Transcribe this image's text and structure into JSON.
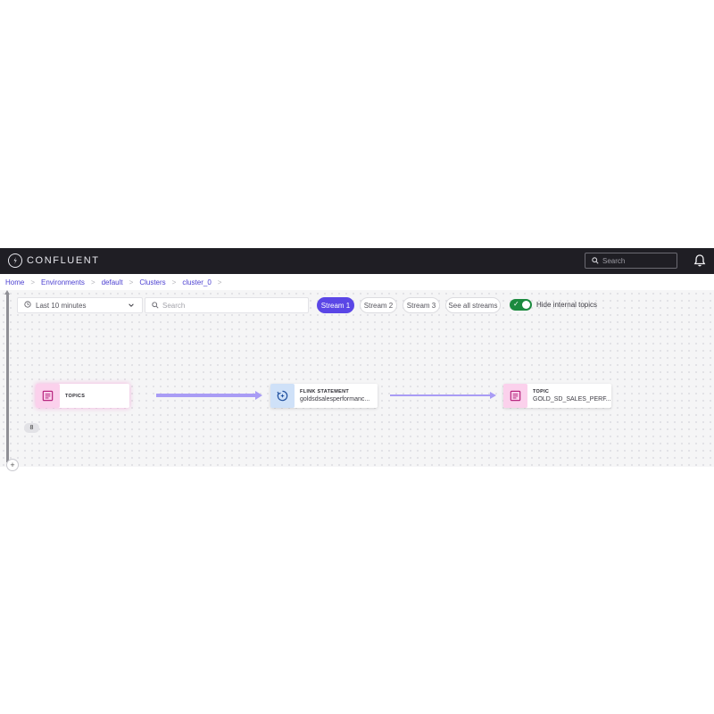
{
  "app": {
    "brand": "CONFLUENT",
    "search_placeholder": "Search"
  },
  "breadcrumb": [
    "Home",
    "Environments",
    "default",
    "Clusters",
    "cluster_0"
  ],
  "toolbar": {
    "time_range": "Last 10 minutes",
    "search_placeholder": "Search",
    "streams": [
      {
        "label": "Stream 1",
        "active": true
      },
      {
        "label": "Stream 2",
        "active": false
      },
      {
        "label": "Stream 3",
        "active": false
      }
    ],
    "see_all_label": "See all streams",
    "hide_internal_label": "Hide internal topics",
    "hide_internal_on": true
  },
  "graph": {
    "nodes": [
      {
        "type_label": "TOPICS",
        "name": "",
        "icon": "topic-icon",
        "count": "8"
      },
      {
        "type_label": "FLINK STATEMENT",
        "name": "goldsdsalesperformanc...",
        "icon": "flink-statement-icon"
      },
      {
        "type_label": "TOPIC",
        "name": "GOLD_SD_SALES_PERF...",
        "icon": "topic-icon"
      }
    ]
  },
  "colors": {
    "topbar": "#1f1e24",
    "accent": "#5a46e6",
    "toggle_on": "#1c8a3f",
    "topic_icon_bg": "#fbd1ec",
    "flink_icon_bg": "#cfe1f8",
    "edge": "#a99cf5"
  }
}
